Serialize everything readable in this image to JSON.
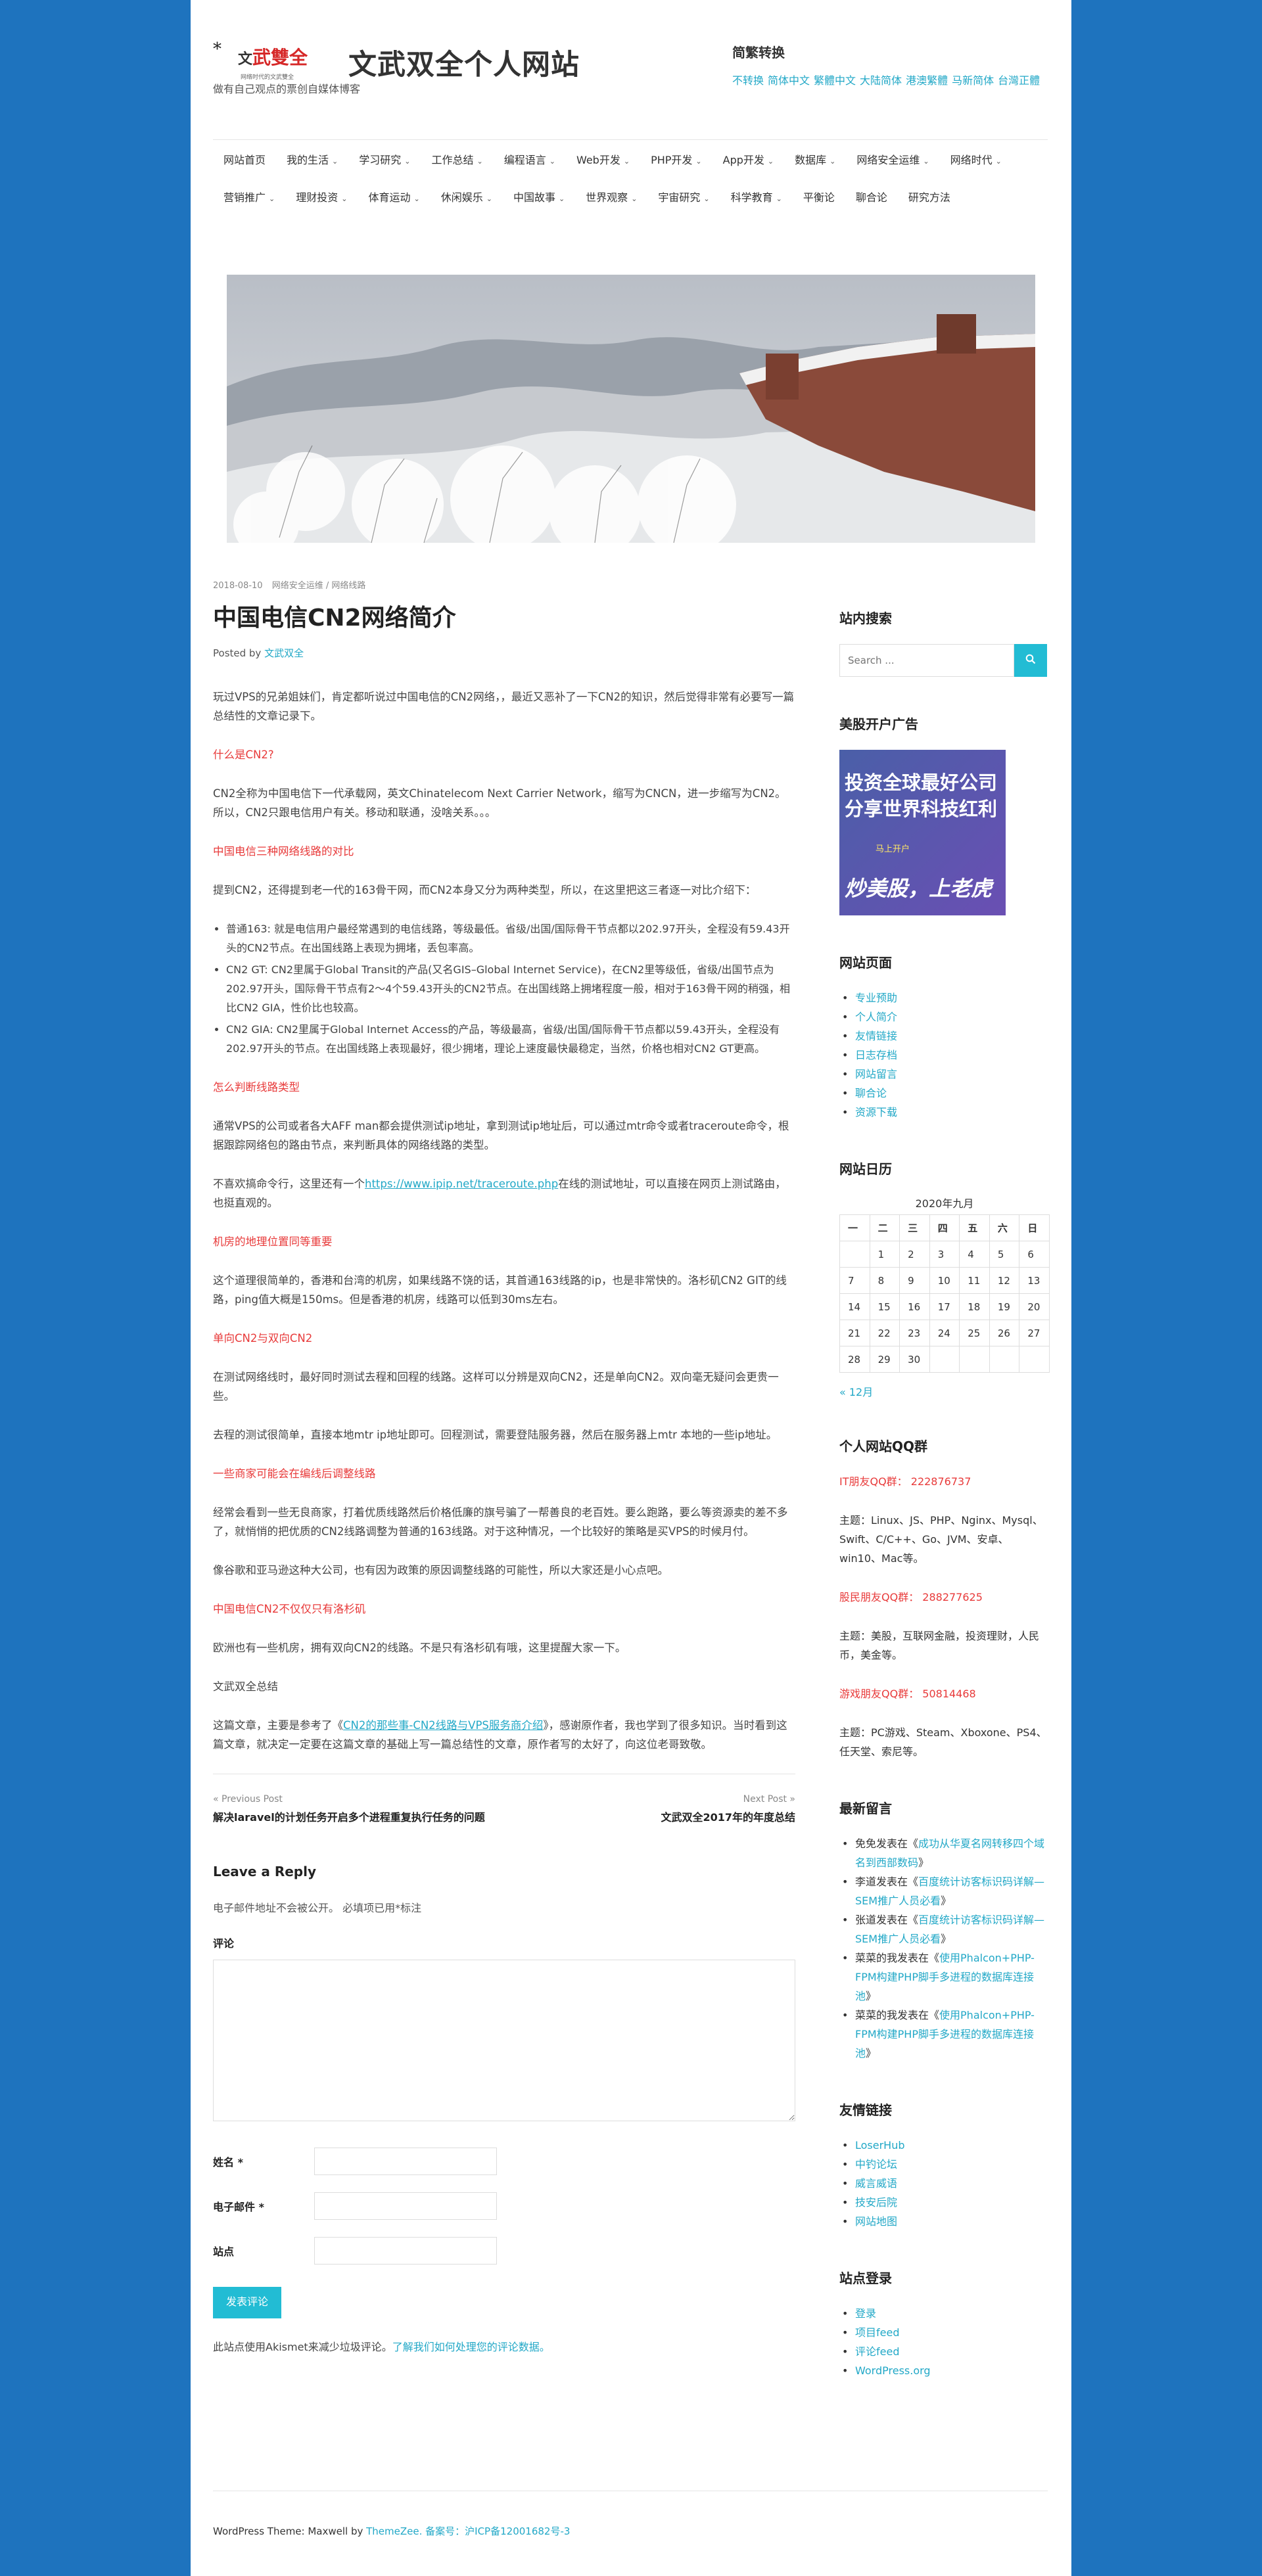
{
  "header": {
    "logo": {
      "star": "*",
      "text_a": "文",
      "text_b": "武",
      "text_c": "雙全",
      "subline": "网络时代的文武雙全"
    },
    "site_title": "文武双全个人网站",
    "tagline": "做有自己观点的票创自媒体博客",
    "convert": {
      "title": "简繁转换",
      "links": [
        "不转换",
        "简体中文",
        "繁體中文",
        "大陆简体",
        "港澳繁體",
        "马新简体",
        "台灣正體"
      ]
    }
  },
  "nav": {
    "items": [
      {
        "label": "网站首页",
        "dropdown": false
      },
      {
        "label": "我的生活",
        "dropdown": true
      },
      {
        "label": "学习研究",
        "dropdown": true
      },
      {
        "label": "工作总结",
        "dropdown": true
      },
      {
        "label": "编程语言",
        "dropdown": true
      },
      {
        "label": "Web开发",
        "dropdown": true
      },
      {
        "label": "PHP开发",
        "dropdown": true
      },
      {
        "label": "App开发",
        "dropdown": true
      },
      {
        "label": "数据库",
        "dropdown": true
      },
      {
        "label": "网络安全运维",
        "dropdown": true
      },
      {
        "label": "网络时代",
        "dropdown": true
      },
      {
        "label": "营销推广",
        "dropdown": true
      },
      {
        "label": "理财投资",
        "dropdown": true
      },
      {
        "label": "体育运动",
        "dropdown": true
      },
      {
        "label": "休闲娱乐",
        "dropdown": true
      },
      {
        "label": "中国故事",
        "dropdown": true
      },
      {
        "label": "世界观察",
        "dropdown": true
      },
      {
        "label": "宇宙研究",
        "dropdown": true
      },
      {
        "label": "科学教育",
        "dropdown": true
      },
      {
        "label": "平衡论",
        "dropdown": false
      },
      {
        "label": "聊合论",
        "dropdown": false
      },
      {
        "label": "研究方法",
        "dropdown": false
      }
    ]
  },
  "post": {
    "date": "2018-08-10",
    "categories": "网络安全运维 / 网络线路",
    "title": "中国电信CN2网络简介",
    "posted_by_label": "Posted by",
    "author": "文武双全",
    "p1": "玩过VPS的兄弟姐妹们，肯定都听说过中国电信的CN2网络，，最近又恶补了一下CN2的知识，然后觉得非常有必要写一篇总结性的文章记录下。",
    "h1": "什么是CN2?",
    "p2": "CN2全称为中国电信下一代承载网，英文Chinatelecom Next Carrier Network，缩写为CNCN，进一步缩写为CN2。所以，CN2只跟电信用户有关。移动和联通，没啥关系。。。",
    "h2": "中国电信三种网络线路的对比",
    "p3": "提到CN2，还得提到老一代的163骨干网，而CN2本身又分为两种类型，所以，在这里把这三者逐一对比介绍下：",
    "list": [
      "普通163: 就是电信用户最经常遇到的电信线路，等级最低。省级/出国/国际骨干节点都以202.97开头，全程没有59.43开头的CN2节点。在出国线路上表现为拥堵，丢包率高。",
      "CN2 GT: CN2里属于Global Transit的产品(又名GIS–Global Internet Service)，在CN2里等级低，省级/出国节点为202.97开头，国际骨干节点有2～4个59.43开头的CN2节点。在出国线路上拥堵程度一般，相对于163骨干网的稍强，相比CN2 GIA，性价比也较高。",
      "CN2 GIA: CN2里属于Global Internet Access的产品，等级最高，省级/出国/国际骨干节点都以59.43开头，全程没有202.97开头的节点。在出国线路上表现最好，很少拥堵，理论上速度最快最稳定，当然，价格也相对CN2 GT更高。"
    ],
    "h3": "怎么判断线路类型",
    "p4": "通常VPS的公司或者各大AFF man都会提供测试ip地址，拿到测试ip地址后，可以通过mtr命令或者traceroute命令，根据跟踪网络包的路由节点，来判断具体的网络线路的类型。",
    "p5_pre": "不喜欢搞命令行，这里还有一个",
    "p5_link": "https://www.ipip.net/traceroute.php",
    "p5_post": "在线的测试地址，可以直接在网页上测试路由，也挺直观的。",
    "h4": "机房的地理位置同等重要",
    "p6": "这个道理很简单的，香港和台湾的机房，如果线路不饶的话，其首通163线路的ip，也是非常快的。洛杉矶CN2 GIT的线路，ping值大概是150ms。但是香港的机房，线路可以低到30ms左右。",
    "h5": "单向CN2与双向CN2",
    "p7": "在测试网络线时，最好同时测试去程和回程的线路。这样可以分辨是双向CN2，还是单向CN2。双向毫无疑问会更贵一些。",
    "p8": "去程的测试很简单，直接本地mtr ip地址即可。回程测试，需要登陆服务器，然后在服务器上mtr 本地的一些ip地址。",
    "h6": "一些商家可能会在编线后调整线路",
    "p9": "经常会看到一些无良商家，打着优质线路然后价格低廉的旗号骗了一帮善良的老百姓。要么跑路，要么等资源卖的差不多了，就悄悄的把优质的CN2线路调整为普通的163线路。对于这种情况，一个比较好的策略是买VPS的时候月付。",
    "p10": "像谷歌和亚马逊这种大公司，也有因为政策的原因调整线路的可能性，所以大家还是小心点吧。",
    "h7": "中国电信CN2不仅仅只有洛杉矶",
    "p11": "欧洲也有一些机房，拥有双向CN2的线路。不是只有洛杉矶有哦，这里提醒大家一下。",
    "p12": "文武双全总结",
    "p13_pre": "这篇文章，主要是参考了《",
    "p13_link": "CN2的那些事-CN2线路与VPS服务商介绍",
    "p13_post": "》，感谢原作者，我也学到了很多知识。当时看到这篇文章，就决定一定要在这篇文章的基础上写一篇总结性的文章，原作者写的太好了，向这位老哥致敬。"
  },
  "post_nav": {
    "prev_label": "« Previous Post",
    "prev_title": "解决laravel的计划任务开启多个进程重复执行任务的问题",
    "next_label": "Next Post »",
    "next_title": "文武双全2017年的年度总结"
  },
  "reply": {
    "title": "Leave a Reply",
    "notes": "电子邮件地址不会被公开。 必填项已用*标注",
    "comment_label": "评论",
    "name_label": "姓名 *",
    "email_label": "电子邮件 *",
    "site_label": "站点",
    "submit": "发表评论",
    "akismet_pre": "此站点使用Akismet来减少垃圾评论。",
    "akismet_link": "了解我们如何处理您的评论数据。"
  },
  "sidebar": {
    "search": {
      "title": "站内搜索",
      "placeholder": "Search ..."
    },
    "ad": {
      "title": "美股开户广告",
      "line1": "投资全球最好公司",
      "line2": "分享世界科技红利",
      "small": "马上开户",
      "line3": "炒美股，上老虎"
    },
    "pages": {
      "title": "网站页面",
      "items": [
        "专业预助",
        "个人简介",
        "友情链接",
        "日志存档",
        "网站留言",
        "聊合论",
        "资源下载"
      ]
    },
    "calendar": {
      "title": "网站日历",
      "caption": "2020年九月",
      "headers": [
        "一",
        "二",
        "三",
        "四",
        "五",
        "六",
        "日"
      ],
      "rows": [
        [
          "",
          "1",
          "2",
          "3",
          "4",
          "5",
          "6"
        ],
        [
          "7",
          "8",
          "9",
          "10",
          "11",
          "12",
          "13"
        ],
        [
          "14",
          "15",
          "16",
          "17",
          "18",
          "19",
          "20"
        ],
        [
          "21",
          "22",
          "23",
          "24",
          "25",
          "26",
          "27"
        ],
        [
          "28",
          "29",
          "30",
          "",
          "",
          "",
          ""
        ]
      ],
      "prev": "« 12月"
    },
    "qq": {
      "title": "个人网站QQ群",
      "g1": "IT朋友QQ群： 222876737",
      "g1_desc": "主题：Linux、JS、PHP、Nginx、Mysql、Swift、C/C++、Go、JVM、安卓、win10、Mac等。",
      "g2": "股民朋友QQ群： 288277625",
      "g2_desc": "主题：美股，互联网金融，投资理财，人民币，美金等。",
      "g3": "游戏朋友QQ群： 50814468",
      "g3_desc": "主题：PC游戏、Steam、Xboxone、PS4、任天堂、索尼等。"
    },
    "recent": {
      "title": "最新留言",
      "items": [
        {
          "who": "免免",
          "mid": "发表在《",
          "link": "成功从华夏名网转移四个域名到西部数码",
          "end": "》"
        },
        {
          "who": "李道",
          "mid": "发表在《",
          "link": "百度统计访客标识码详解—SEM推广人员必看",
          "end": "》"
        },
        {
          "who": "张道",
          "mid": "发表在《",
          "link": "百度统计访客标识码详解—SEM推广人员必看",
          "end": "》"
        },
        {
          "who": "菜菜的我",
          "mid": "发表在《",
          "link": "使用Phalcon+PHP-FPM构建PHP脚手多进程的数据库连接池",
          "end": "》"
        },
        {
          "who": "菜菜的我",
          "mid": "发表在《",
          "link": "使用Phalcon+PHP-FPM构建PHP脚手多进程的数据库连接池",
          "end": "》"
        }
      ]
    },
    "links": {
      "title": "友情链接",
      "items": [
        "LoserHub",
        "中钓论坛",
        "威言威语",
        "技安后院",
        "网站地图"
      ]
    },
    "login": {
      "title": "站点登录",
      "items": [
        "登录",
        "项目feed",
        "评论feed",
        "WordPress.org"
      ]
    }
  },
  "footer": {
    "pre": "WordPress Theme: Maxwell by ",
    "theme_link": "ThemeZee.",
    "icp": " 备案号：沪ICP备12001682号-3"
  }
}
